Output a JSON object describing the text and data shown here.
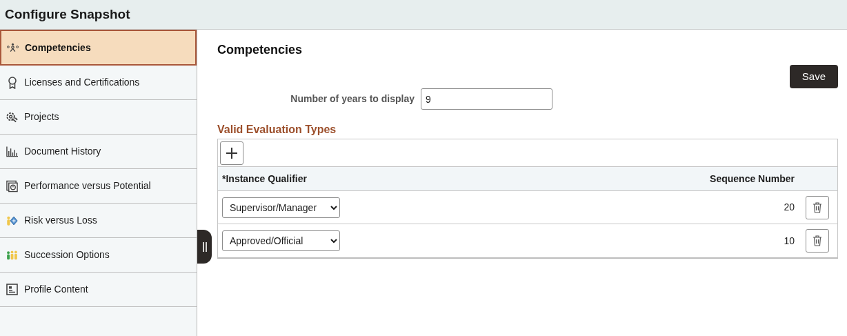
{
  "window": {
    "title": "Configure Snapshot"
  },
  "sidebar": {
    "items": [
      {
        "label": "Competencies",
        "selected": true
      },
      {
        "label": "Licenses and Certifications",
        "selected": false
      },
      {
        "label": "Projects",
        "selected": false
      },
      {
        "label": "Document History",
        "selected": false
      },
      {
        "label": "Performance versus Potential",
        "selected": false
      },
      {
        "label": "Risk versus Loss",
        "selected": false
      },
      {
        "label": "Succession Options",
        "selected": false
      },
      {
        "label": "Profile Content",
        "selected": false
      }
    ]
  },
  "content": {
    "title": "Competencies",
    "save_button": "Save",
    "years_field": {
      "label": "Number of years to display",
      "value": "9"
    },
    "section_title": "Valid Evaluation Types",
    "table": {
      "columns": [
        "*Instance Qualifier",
        "Sequence Number"
      ],
      "rows": [
        {
          "qualifier": "Supervisor/Manager",
          "sequence": "20"
        },
        {
          "qualifier": "Approved/Official",
          "sequence": "10"
        }
      ]
    }
  }
}
